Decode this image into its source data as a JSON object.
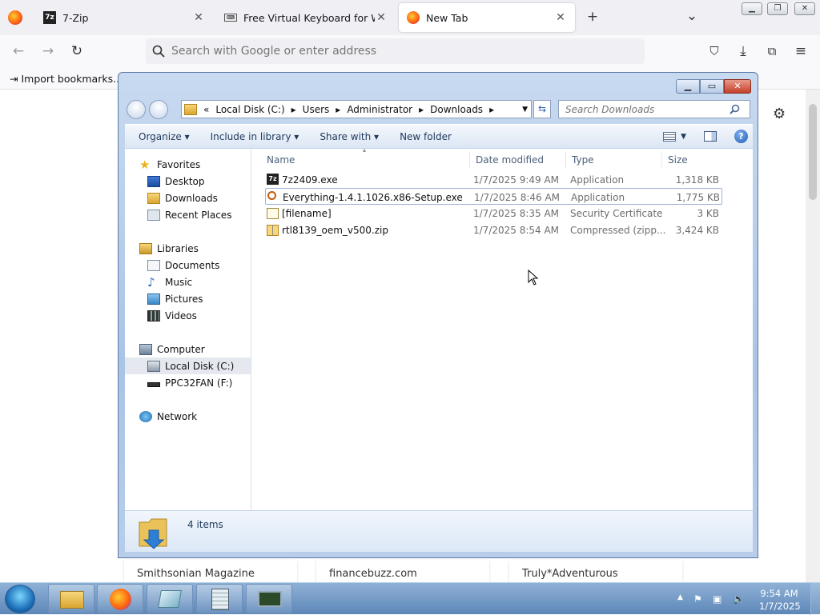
{
  "browser": {
    "tabs": [
      {
        "label": "7-Zip",
        "icon": "7zip-icon",
        "active": false
      },
      {
        "label": "Free Virtual Keyboard for Windo",
        "icon": "keyboard-icon",
        "active": false
      },
      {
        "label": "New Tab",
        "icon": "firefox-icon",
        "active": true
      }
    ],
    "new_tab": "+",
    "tab_list": "⌄",
    "address_placeholder": "Search with Google or enter address",
    "bookmarks_import": "Import bookmarks...",
    "tiles": [
      "Smithsonian Magazine",
      "financebuzz.com",
      "Truly*Adventurous"
    ]
  },
  "explorer": {
    "breadcrumb": [
      "«",
      "Local Disk (C:)",
      "▸",
      "Users",
      "▸",
      "Administrator",
      "▸",
      "Downloads",
      "▸"
    ],
    "search_placeholder": "Search Downloads",
    "commands": [
      "Organize ▾",
      "Include in library ▾",
      "Share with ▾",
      "New folder"
    ],
    "nav": {
      "favorites": "Favorites",
      "desktop": "Desktop",
      "downloads": "Downloads",
      "recent": "Recent Places",
      "libraries": "Libraries",
      "documents": "Documents",
      "music": "Music",
      "pictures": "Pictures",
      "videos": "Videos",
      "computer": "Computer",
      "local_disk": "Local Disk (C:)",
      "usb": "PPC32FAN (F:)",
      "network": "Network"
    },
    "columns": {
      "name": "Name",
      "date": "Date modified",
      "type": "Type",
      "size": "Size"
    },
    "files": [
      {
        "name": "7z2409.exe",
        "date": "1/7/2025 9:49 AM",
        "type": "Application",
        "size": "1,318 KB",
        "icon": "7zip-icon"
      },
      {
        "name": "Everything-1.4.1.1026.x86-Setup.exe",
        "date": "1/7/2025 8:46 AM",
        "type": "Application",
        "size": "1,775 KB",
        "icon": "magnifier-icon"
      },
      {
        "name": "[filename]",
        "date": "1/7/2025 8:35 AM",
        "type": "Security Certificate",
        "size": "3 KB",
        "icon": "certificate-icon"
      },
      {
        "name": "rtl8139_oem_v500.zip",
        "date": "1/7/2025 8:54 AM",
        "type": "Compressed (zipp...",
        "size": "3,424 KB",
        "icon": "zip-folder-icon"
      }
    ],
    "status": "4 items"
  },
  "taskbar": {
    "clock_time": "9:54 AM",
    "clock_date": "1/7/2025",
    "tray_up": "▲"
  }
}
